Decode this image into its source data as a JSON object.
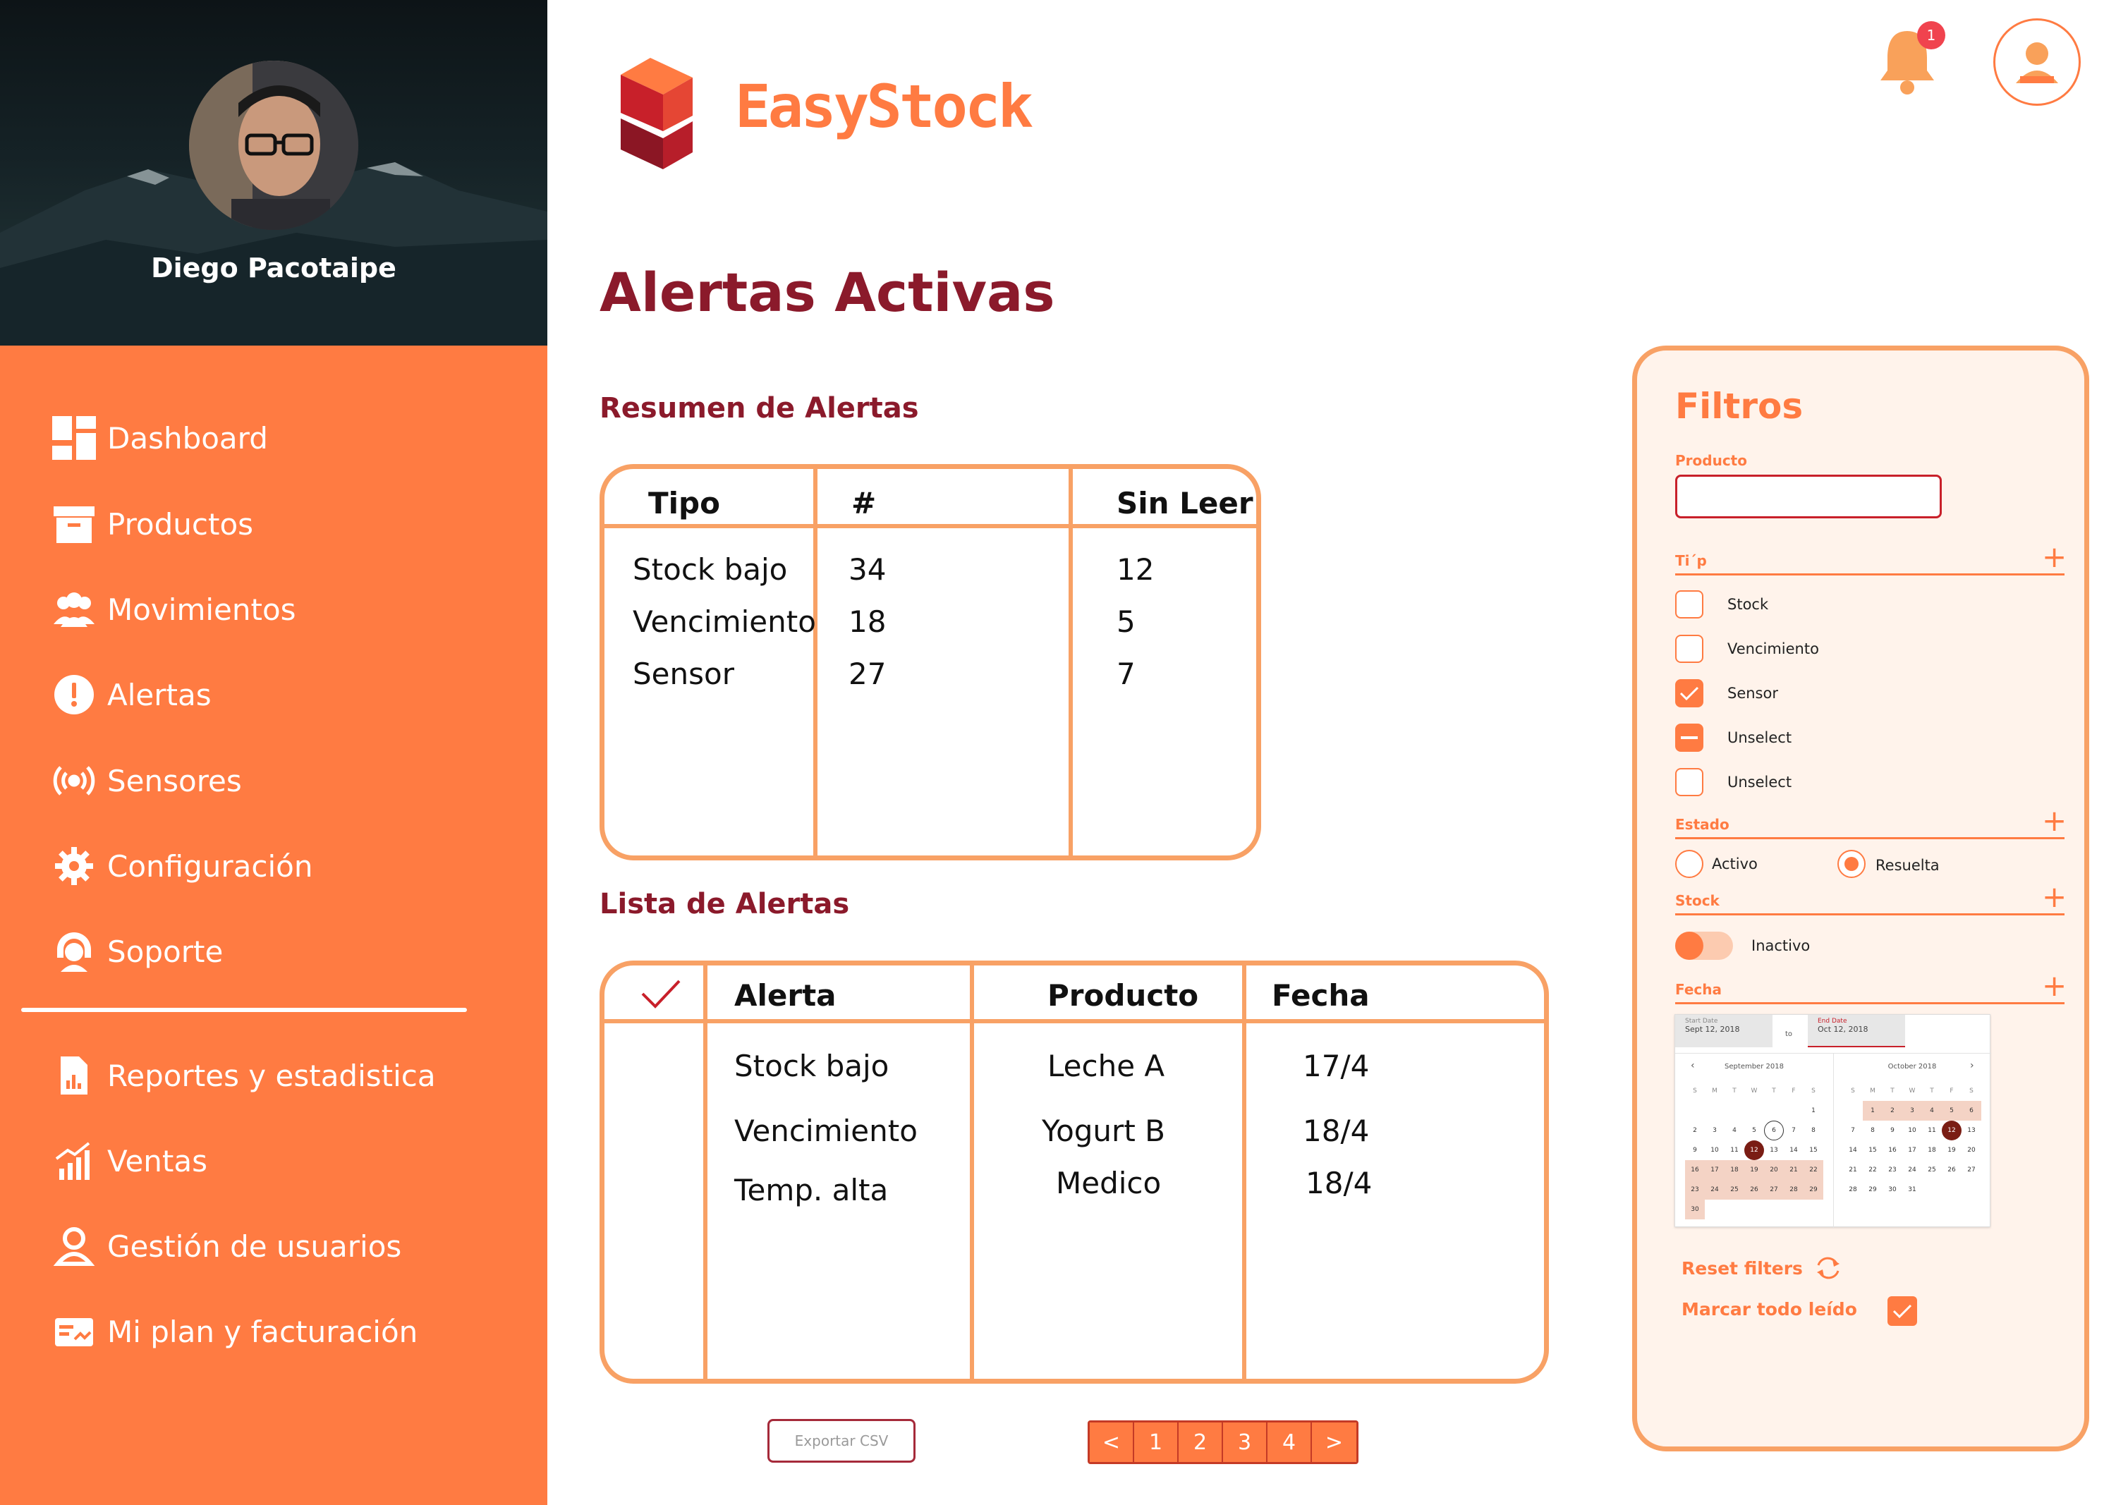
{
  "brand": {
    "name": "EasyStock"
  },
  "profile": {
    "name": "Diego Pacotaipe"
  },
  "notifications": {
    "count": "1"
  },
  "nav": {
    "items": [
      {
        "label": "Dashboard",
        "icon": "dashboard-icon"
      },
      {
        "label": "Productos",
        "icon": "box-icon"
      },
      {
        "label": "Movimientos",
        "icon": "users-icon"
      },
      {
        "label": "Alertas",
        "icon": "alert-icon"
      },
      {
        "label": "Sensores",
        "icon": "sensor-icon"
      },
      {
        "label": "Configuración",
        "icon": "gear-icon"
      },
      {
        "label": "Soporte",
        "icon": "support-icon"
      },
      {
        "label": "Reportes y estadistica",
        "icon": "report-icon"
      },
      {
        "label": "Ventas",
        "icon": "sales-icon"
      },
      {
        "label": "Gestión de usuarios",
        "icon": "user-icon"
      },
      {
        "label": "Mi plan y facturación",
        "icon": "billing-icon"
      }
    ]
  },
  "page": {
    "title": "Alertas Activas"
  },
  "summary": {
    "title": "Resumen de Alertas",
    "headers": [
      "Tipo",
      "#",
      "Sin Leer"
    ],
    "rows": [
      [
        "Stock bajo",
        "34",
        "12"
      ],
      [
        "Vencimiento",
        "18",
        "5"
      ],
      [
        "Sensor",
        "27",
        "7"
      ]
    ]
  },
  "alerts": {
    "title": "Lista de Alertas",
    "headers": [
      "Alerta",
      "Producto",
      "Fecha"
    ],
    "rows": [
      [
        "Stock bajo",
        "Leche A",
        "17/4"
      ],
      [
        "Vencimiento",
        "Yogurt B",
        "18/4"
      ],
      [
        "Temp. alta",
        "Medico",
        "18/4"
      ]
    ]
  },
  "export": {
    "label": "Exportar CSV"
  },
  "pager": {
    "prev": "<",
    "pages": [
      "1",
      "2",
      "3",
      "4"
    ],
    "next": ">"
  },
  "filters": {
    "title": "Filtros",
    "producto_label": "Producto",
    "producto_value": "",
    "tipo_label": "Ti´p",
    "tipo_options": [
      {
        "label": "Stock",
        "state": "unchecked"
      },
      {
        "label": "Vencimiento",
        "state": "unchecked"
      },
      {
        "label": "Sensor",
        "state": "checked"
      },
      {
        "label": "Unselect",
        "state": "indeterminate"
      },
      {
        "label": "Unselect",
        "state": "unchecked"
      }
    ],
    "estado_label": "Estado",
    "estado_options": [
      {
        "label": "Activo",
        "selected": false
      },
      {
        "label": "Resuelta",
        "selected": true
      }
    ],
    "stock_label": "Stock",
    "stock_toggle_label": "Inactivo",
    "fecha_label": "Fecha",
    "datepicker": {
      "start_label": "Start Date",
      "start_value": "Sept 12, 2018",
      "to": "to",
      "end_label": "End Date",
      "end_value": "Oct 12, 2018",
      "prev": "‹",
      "next": "›",
      "left_month": "September 2018",
      "right_month": "October 2018",
      "weekdays": [
        "S",
        "M",
        "T",
        "W",
        "T",
        "F",
        "S"
      ]
    },
    "reset_label": "Reset filters",
    "mark_all_label": "Marcar todo leído"
  },
  "colors": {
    "accent": "#FF7B42",
    "title": "#8B1A2B",
    "border": "#F8A165",
    "panel": "#FFF3EB"
  }
}
